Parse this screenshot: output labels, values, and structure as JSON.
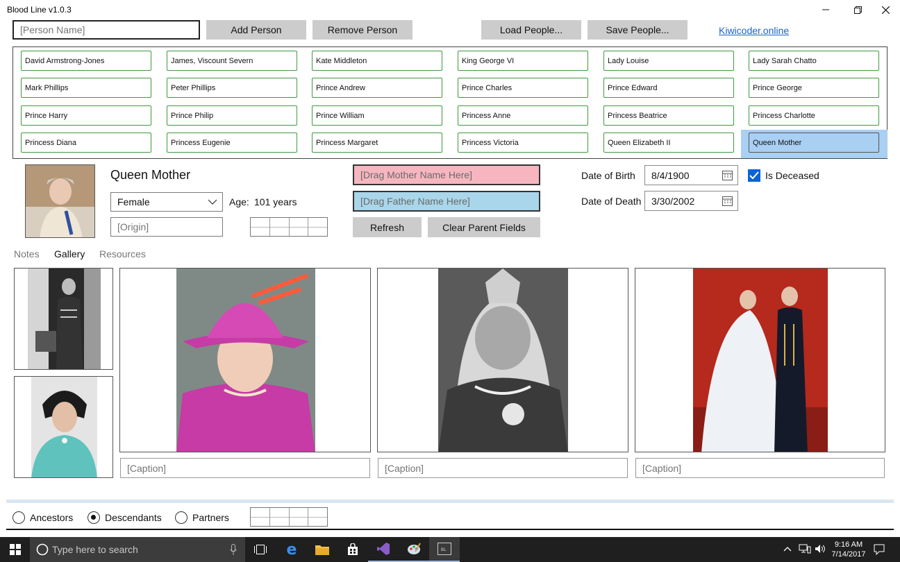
{
  "window": {
    "title": "Blood Line v1.0.3"
  },
  "toolbar": {
    "name_placeholder": "[Person Name]",
    "add_label": "Add Person",
    "remove_label": "Remove Person",
    "load_label": "Load People...",
    "save_label": "Save People...",
    "link_label": "Kiwicoder.online"
  },
  "people": [
    [
      "David Armstrong-Jones",
      "James, Viscount Severn",
      "Kate Middleton",
      "King George VI",
      "Lady Louise",
      "Lady Sarah Chatto"
    ],
    [
      "Mark Phillips",
      "Peter Phillips",
      "Prince Andrew",
      "Prince Charles",
      "Prince Edward",
      "Prince George"
    ],
    [
      "Prince Harry",
      "Prince Philip",
      "Prince William",
      "Princess Anne",
      "Princess Beatrice",
      "Princess Charlotte"
    ],
    [
      "Princess Diana",
      "Princess Eugenie",
      "Princess Margaret",
      "Princess Victoria",
      "Queen Elizabeth II",
      "Queen Mother"
    ]
  ],
  "selected_person": "Queen Mother",
  "details": {
    "name": "Queen Mother",
    "gender": "Female",
    "age_label": "Age:",
    "age_value": "101 years",
    "origin_placeholder": "[Origin]",
    "mother_placeholder": "[Drag Mother Name Here]",
    "father_placeholder": "[Drag Father Name Here]",
    "refresh_label": "Refresh",
    "clear_label": "Clear Parent Fields",
    "dob_label": "Date of Birth",
    "dob_value": "8/4/1900",
    "dod_label": "Date of Death",
    "dod_value": "3/30/2002",
    "deceased_label": "Is Deceased",
    "deceased_checked": true
  },
  "tabs": {
    "notes": "Notes",
    "gallery": "Gallery",
    "resources": "Resources",
    "active": "Gallery"
  },
  "gallery": {
    "caption_placeholder": "[Caption]"
  },
  "view_modes": {
    "ancestors": "Ancestors",
    "descendants": "Descendants",
    "partners": "Partners",
    "selected": "Descendants"
  },
  "taskbar": {
    "search_placeholder": "Type here to search",
    "time": "9:16 AM",
    "date": "7/14/2017"
  },
  "colors": {
    "mother_bg": "#f7b6bf",
    "father_bg": "#a9d6ea",
    "selected_bg": "#a9cff3",
    "person_border": "#3d9a3d",
    "link": "#1a62c4"
  }
}
